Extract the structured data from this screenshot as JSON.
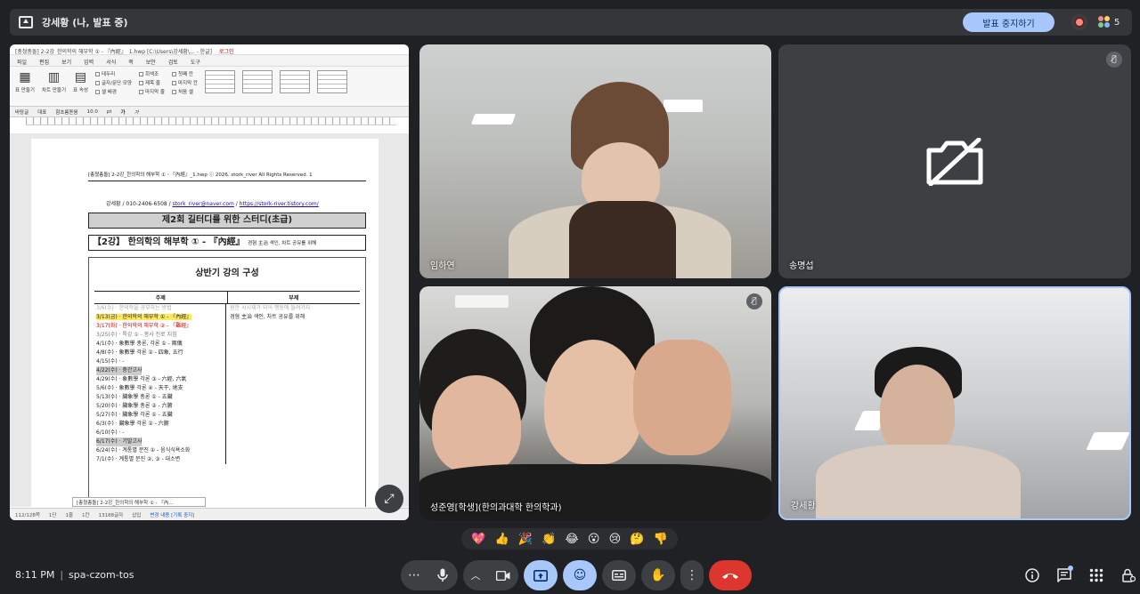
{
  "topbar": {
    "title": "강세황 (나, 발표 중)",
    "stop_label": "발표 중지하기",
    "participant_count": "5"
  },
  "share": {
    "window_title": "[총쳤총돌] 2-2강_한의학의 해부학 ① - 『內經』_1.hwp [C:\\Users\\강세황\\... - 한글]",
    "login": "로그인",
    "menu": [
      "파일",
      "편집",
      "보기",
      "입력",
      "서식",
      "쪽",
      "보안",
      "검토",
      "도구"
    ],
    "ribbon": {
      "table_btn": "표 만들기",
      "chart_btn": "차트 만들기",
      "prop_btn": "표 속성",
      "checks": [
        "테두리",
        "글자/문단 모양",
        "셀 배경",
        "제목 줄",
        "마지막 줄",
        "첫째 칸",
        "마지막 칸",
        "처음 셀"
      ],
      "checks2": [
        "회색조"
      ]
    },
    "format_bar": [
      "바탕글",
      "대표",
      "함초롬돋움",
      "10.0",
      "pt",
      "가",
      "가"
    ],
    "page": {
      "header": "[총쳤총돌] 2-2강_한의학의 해부학 ① - 『內經』_1.hwp ⓒ 2026. stork_river All Rights Reserved.    1",
      "contact": "강세황 / 010-2406-6508 / ",
      "email": "stork_river@naver.com",
      "slash": " / ",
      "url": "https://stork-river.tistory.com/",
      "h1": "제2회 길터디를 위한 스터디(초급)",
      "h2": "【2강】 한의학의 해부학 ① - 『內經』",
      "h2_note": "경혐 主治 색인, 차트 공유를 위해",
      "box_title": "상반기 강의 구성",
      "col_left": "주제",
      "col_right": "부제",
      "rows": [
        {
          "l": "3/6(수) · 한의학을 공부하는 방법",
          "r": "원한 시시재가 되어 행동에 들려가자",
          "cls": "gray"
        },
        {
          "l": "3/13(금) · 한의학의 해부학 ① - 『內經』",
          "r": "경혐 主治 색인, 차트 공유를 위해",
          "cls": "hl"
        },
        {
          "l": "3/17(화) · 한의학의 해부학 ② - 『難經』",
          "r": "",
          "cls": "red"
        },
        {
          "l": "3/25(수) · 특강 ① - 봉사 진로 지침",
          "r": "",
          "cls": "blue"
        },
        {
          "l": "4/1(수) · 象數學 총론, 각론 ① - 兩儀",
          "r": "",
          "cls": ""
        },
        {
          "l": "4/8(수) · 象數學 각론 ② - 四象, 五行",
          "r": "",
          "cls": ""
        },
        {
          "l": "4/15(수) · -",
          "r": "",
          "cls": ""
        },
        {
          "l": "4/22(수) · 중간고사",
          "r": "",
          "cls": "sh"
        },
        {
          "l": "4/29(수) · 象數學 각론 ③ - 六經, 六氣",
          "r": "",
          "cls": ""
        },
        {
          "l": "5/6(수) · 象數學 각론 ④ - 天干, 地支",
          "r": "",
          "cls": ""
        },
        {
          "l": "5/13(수) · 臟象學 총론 ① - 五臟",
          "r": "",
          "cls": ""
        },
        {
          "l": "5/20(수) · 臟象學 총론 ② - 六腑",
          "r": "",
          "cls": ""
        },
        {
          "l": "5/27(수) · 臟象學 각론 ① - 五臟",
          "r": "",
          "cls": ""
        },
        {
          "l": "6/3(수) · 臟象學 각론 ② - 六腑",
          "r": "",
          "cls": ""
        },
        {
          "l": "6/10(수) · -",
          "r": "",
          "cls": ""
        },
        {
          "l": "6/17(수) · 기말고사",
          "r": "",
          "cls": "sh"
        },
        {
          "l": "6/24(수) · 계통별 문진 ① - 음식식욕소화",
          "r": "",
          "cls": ""
        },
        {
          "l": "7/1(수) · 계통별 문진 ②, ③ - 대소변",
          "r": "",
          "cls": ""
        }
      ]
    },
    "doc_tab": "[총쳤총돌] 2-2강_한의학의 해부학 ① - 『內...",
    "status": [
      "112/128쪽",
      "1단",
      "1줄",
      "1칸",
      "13188글자",
      "삽입",
      "변경 내용 [기록 중지]"
    ]
  },
  "tiles": {
    "t1_name": "임하연",
    "t2_name": "송명섭",
    "t3_name": "성준영[학생](한의과대학 한의학과)",
    "t4_name": "강세황"
  },
  "reactions": [
    "💖",
    "👍",
    "🎉",
    "👏",
    "😂",
    "😮",
    "😢",
    "🤔",
    "👎"
  ],
  "bottom": {
    "time": "8:11 PM",
    "meeting_code": "spa-czom-tos"
  },
  "colors": {
    "accent": "#a8c7fa",
    "end_call": "#dc362e",
    "bg": "#202124"
  }
}
